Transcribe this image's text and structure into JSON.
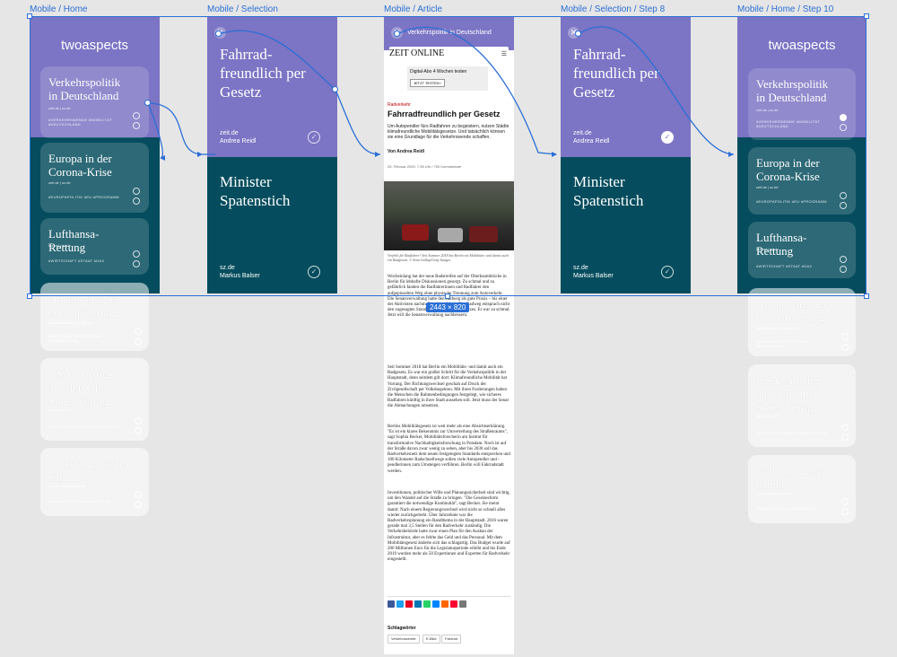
{
  "frames": {
    "home": "Mobile / Home",
    "selection": "Mobile / Selection",
    "article": "Mobile / Article",
    "step8": "Mobile / Selection / Step 8",
    "step10": "Mobile / Home / Step 10"
  },
  "app": {
    "logo": "twoaspects"
  },
  "cards": [
    {
      "title": "Verkehrspolitik in Deutschland",
      "source": "zeit.de | sz.de",
      "tags": "#VERKEHRSWENDE #MOBILITÄT #DEUTSCHLAND"
    },
    {
      "title": "Europa in der Corona-Krise",
      "source": "zeit.de | sz.de",
      "tags": "#EUROPAPOLITIK #EU #PROGRAMM"
    },
    {
      "title": "Lufthansa-Rettung",
      "source": "faz.net | sz.de",
      "tags": "#WIRTSCHAFT #STAAT #DAX"
    },
    {
      "title": "Abkehr aus der Globalisierung",
      "source": "handelsblatt.de | spiegel.de",
      "tags": "#WIRTSCHAFT #ZERSTÖRUNG #INTERNATIONAL"
    },
    {
      "title": "USA: Austieg aus den Open-Skies-Vetrag?",
      "source": "zeit.de | sz.de",
      "tags": "#POLITIK #USA #RÜSTUNGSKONTROLLE"
    },
    {
      "title": "Volkskongress in China",
      "source": "n-tv.de | tagesschau.de",
      "tags": "#CHINA #POLITIK #AUSSENPOLITIK"
    }
  ],
  "step10_cards": [
    {
      "title": "Verkehrspolitik in Deutschland",
      "source": "zeit.de | sz.de",
      "tags": "#VERKEHRSWENDE #MOBILITÄT #DEUTSCHLAND"
    },
    {
      "title": "Europa in der Corona-Krise",
      "source": "zeit.de | sz.de",
      "tags": "#EUROPAPOLITIK #EU #PROGRAMM"
    },
    {
      "title": "Lufthansa-Rettung",
      "source": "faz.net | sz.de",
      "tags": "#WIRTSCHAFT #STAAT #DAX"
    },
    {
      "title": "Abkehr aus der Globalisierung",
      "source": "handelsblatt.de | spiegel.de",
      "tags": "#WIRTSCHAFT #ZERSTÖRUNG #INTERNATIONAL"
    },
    {
      "title": "USA: Austieg aus den Open-Skies-Vetrag?",
      "source": "zeit.de | sz.de",
      "tags": "#POLITIK #USA #RÜSTUNGSKONTROLLE"
    },
    {
      "title": "Volkskongress in China",
      "source": "n-tv.de | tagesschau.de",
      "tags": "#CHINA #POLITIK #AUSSENPOLITIK"
    }
  ],
  "selection": {
    "top_title": "Fahrrad-freundlich per Gesetz",
    "top_source": "zeit.de",
    "top_author": "Andrea Reidl",
    "bottom_title": "Minister Spatenstich",
    "bottom_source": "sz.de",
    "bottom_author": "Markus Balser"
  },
  "article": {
    "header": "Verkehrspolitik in Deutschland",
    "brand": "ZEIT ONLINE",
    "ad_title": "Digital-Abo 4 Wochen testen",
    "ad_button": "JETZT TESTEN ›",
    "kicker": "Radverkehr",
    "headline": "Fahrradfreundlich per Gesetz",
    "lead": "Um Autopendler fürs Radfahren zu begeistern, nutzen Städte klimafreundliche Mobilitätsgesetze. Und tatsächlich können sie eine Grundlage für die Verkehrswende schaffen.",
    "byline": "Von Andrea Reidl",
    "dateline": "25. Februar 2020, 7:35 Uhr / 700 Kommentare",
    "caption": "Verfehlt für Radfahrer? Seit Sommer 2018 hat Berlin ein Mobilitäts- und damit auch ein Radgesetz. © Sean Gallup/Getty Images",
    "p1": "Wocheinlang hat der neue Radstreifen auf der Oberbaumbrücke in Berlin für lebhafte Diskussionen gesorgt. Zu schmal und zu gefährlich fanden die Radfahrerinnen und Radfahrer den aufgepinselten Weg ohne physische Trennung zum Autoverkehr. Die Senatsverwaltung hatte den Radweg als gute Praxis – bis einer der Aktivisten nachmaß und bestätigte: Der Radweg entsprach nicht den zugesagten Standards des Mobilitätsgesetzes. Er war zu schmal. Jetzt will die Senatsverwaltung nachbessern.",
    "p2": "Seit Sommer 2018 hat Berlin ein Mobilitäts- und damit auch ein Radgesetz. Es war ein großer Schritt für die Verkehrspolitik in der Hauptstadt, denn seitdem gilt dort: Klimafreundliche Mobilität hat Vorrang. Der Richtungswechsel geschah auf Druck der Zivilgesellschaft per Volksbegehren. Mit ihren Forderungen haben die Menschen die Rahmenbedingungen festgelegt, wie sicheres Radfahren künftig in ihrer Stadt aussehen soll. Jetzt muss der Senat die Abmachungen umsetzen.",
    "p3": "Berlins Mobilitätsgesetz ist weit mehr als eine Absichtserklärung. \"Es ist ein klares Bekenntnis zur Umverteilung des Straßenraums\", sagt Sophia Becker, Mobilitätsforscherin am Institut für transformative Nachhaltigkeitsforschung in Potsdam. Noch ist auf der Straße davon zwar wenig zu sehen, aber bis 2030 soll das Radverkehrsnetz dem neuen festgelegten Standards entsprechen und 100 Kilometer Radschnellwege sollen viele Autopendler und -pendlerinnen zum Umsteigen verführen. Berlin will Fahrradstadt werden.",
    "p4": "Investitionen, politischer Wille und Planungssicherheit sind wichtig, um den Wandel auf die Straße zu bringen. \"Die Gesetzesform garantiert die notwendige Kontinuität\", sagt Becker. Sie meint damit: Nach einem Regierungswechsel wird nicht so schnell alles wieder zurückgedreht. Über Jahrzehnte war die Radverkehrsplanung ein Randthema in der Hauptstadt. 2016 waren gerade mal 3,5 Stellen für den Radverkehr zuständig. Die Verkehrsbehörde hatte zwar einen Plan für den Ausbau der Infrastruktur, aber es fehlte das Geld und das Personal. Mit dem Mobilitätsgesetz änderte sich das schlagartig. Das Budget wurde auf 200 Millionen Euro für die Legislaturperiode erhöht und bis Ende 2019 wurden mehr als 50 Expertinnen und Experten für Radverkehr eingestellt.",
    "keywords_label": "Schlagwörter",
    "keywords": [
      "Verkehrswende",
      "E-Bike",
      "Fahrrad"
    ]
  },
  "selection_badge": "2443 × 820",
  "icons": {
    "close": "close-icon",
    "check": "check-circle-icon",
    "share": "share-icon"
  },
  "colors": {
    "teal": "#054d5e",
    "purple": "#7c74c4",
    "accent": "#2b6fd6"
  }
}
